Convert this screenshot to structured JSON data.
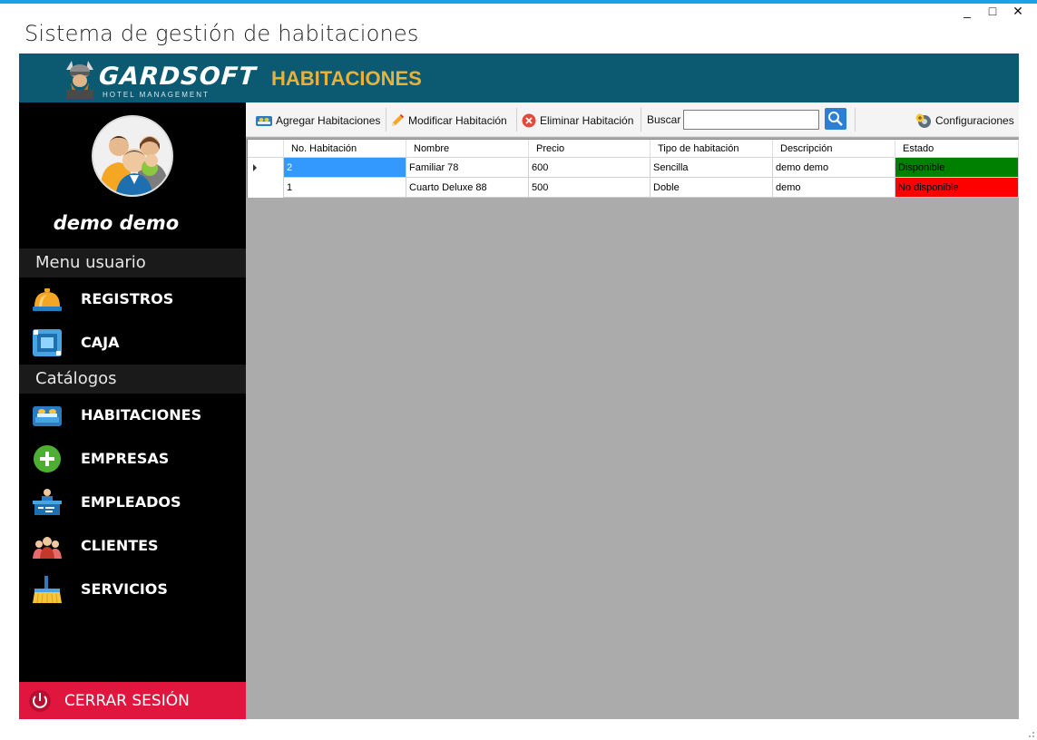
{
  "window": {
    "title": "Sistema de gestión de habitaciones",
    "minimize": "_",
    "maximize": "□",
    "close": "✕"
  },
  "header": {
    "brand": "GARDSOFT",
    "brand_sub": "HOTEL MANAGEMENT",
    "title": "HABITACIONES",
    "bg_color": "#0b5a72",
    "title_color": "#e8b23a"
  },
  "sidebar": {
    "username": "demo demo",
    "sections": {
      "user_menu": "Menu usuario",
      "catalogs": "Catálogos"
    },
    "items": [
      {
        "label": "REGISTROS",
        "icon": "reception-bell-icon"
      },
      {
        "label": "CAJA",
        "icon": "cash-register-icon"
      },
      {
        "label": "HABITACIONES",
        "icon": "bed-icon"
      },
      {
        "label": "EMPRESAS",
        "icon": "plus-circle-icon"
      },
      {
        "label": "EMPLEADOS",
        "icon": "front-desk-icon"
      },
      {
        "label": "CLIENTES",
        "icon": "people-icon"
      },
      {
        "label": "SERVICIOS",
        "icon": "broom-icon"
      }
    ],
    "logout": "CERRAR SESIÓN",
    "logout_color": "#e0163f"
  },
  "toolbar": {
    "add": "Agregar Habitaciones",
    "modify": "Modificar Habitación",
    "delete": "Eliminar Habitación",
    "search_label": "Buscar",
    "search_value": "",
    "settings": "Configuraciones"
  },
  "table": {
    "columns": [
      "No. Habitación",
      "Nombre",
      "Precio",
      "Tipo de habitación",
      "Descripción",
      "Estado"
    ],
    "rows": [
      {
        "numero": "2",
        "nombre": "Familiar 78",
        "precio": "600",
        "tipo": "Sencilla",
        "descripcion": "demo demo",
        "estado": "Disponible",
        "estado_color": "#008000"
      },
      {
        "numero": "1",
        "nombre": "Cuarto Deluxe 88",
        "precio": "500",
        "tipo": "Doble",
        "descripcion": "demo",
        "estado": "No disponible",
        "estado_color": "#ff0000"
      }
    ],
    "selected_row": 0,
    "selection_color": "#3399ff"
  }
}
